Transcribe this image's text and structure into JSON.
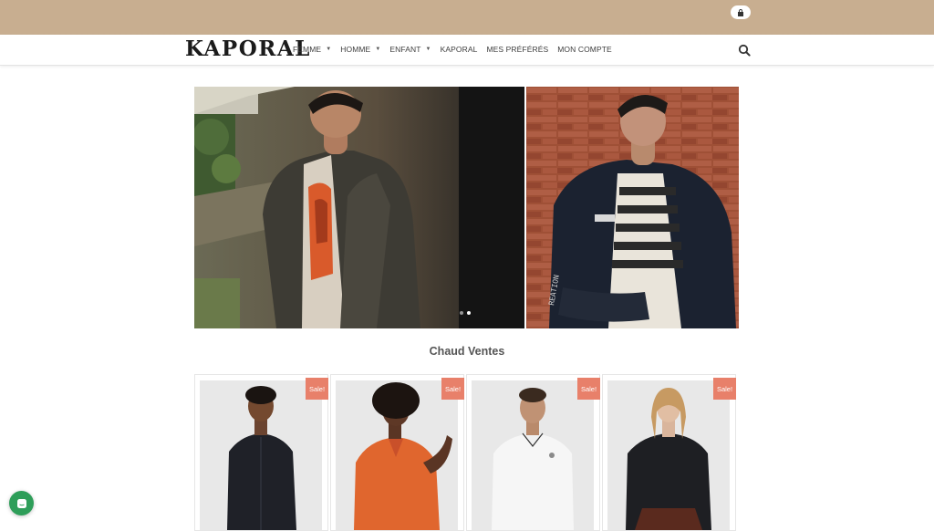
{
  "header": {
    "logo": "KAPORAL",
    "cart_icon": "bag-icon",
    "search_icon": "search-icon"
  },
  "nav": {
    "items": [
      {
        "label": "FEMME",
        "has_dropdown": true
      },
      {
        "label": "HOMME",
        "has_dropdown": true
      },
      {
        "label": "ENFANT",
        "has_dropdown": true
      },
      {
        "label": "KAPORAL",
        "has_dropdown": false
      },
      {
        "label": "MES PRÉFÉRÉS",
        "has_dropdown": false
      },
      {
        "label": "MON COMPTE",
        "has_dropdown": false
      }
    ]
  },
  "hero": {
    "slides": 2,
    "active_slide": 2
  },
  "section": {
    "title": "Chaud Ventes"
  },
  "products": [
    {
      "badge": "Sale!"
    },
    {
      "badge": "Sale!"
    },
    {
      "badge": "Sale!"
    },
    {
      "badge": "Sale!"
    }
  ],
  "colors": {
    "topbar": "#c8ae90",
    "sale_badge": "#e8806a",
    "chat": "#2e9e59"
  },
  "chat": {
    "icon": "chat-icon"
  }
}
